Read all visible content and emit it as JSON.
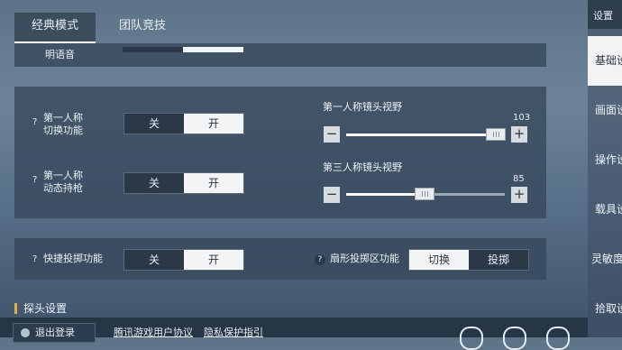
{
  "tabs": [
    {
      "label": "经典模式",
      "active": true
    },
    {
      "label": "团队竞技",
      "active": false
    }
  ],
  "top_partial": {
    "label": "明语音"
  },
  "fpp": {
    "switch": {
      "label_line1": "第一人称",
      "label_line2": "切换功能",
      "off": "关",
      "on": "开",
      "selected": "开"
    },
    "dynamic_hold": {
      "label_line1": "第一人称",
      "label_line2": "动态持枪",
      "off": "关",
      "on": "开",
      "selected": "开"
    },
    "fov_first": {
      "title": "第一人称镜头视野",
      "value": "103",
      "minus": "−",
      "plus": "+",
      "level": 0.94
    },
    "fov_third": {
      "title": "第三人称镜头视野",
      "value": "85",
      "minus": "−",
      "plus": "+",
      "level": 0.49
    }
  },
  "quick_throw": {
    "label": "快捷投掷功能",
    "off": "关",
    "on": "开",
    "selected": "开",
    "fan_label": "扇形投掷区功能",
    "fan_switch": "切换",
    "fan_throw": "投掷",
    "fan_selected": "切换"
  },
  "help_glyph": "?",
  "section_title": "探头设置",
  "footer": {
    "logout": "退出登录",
    "user_agreement": "腾讯游戏用户协议",
    "privacy": "隐私保护指引"
  },
  "sidebar": {
    "title": "设置",
    "items": [
      {
        "label": "基础设置",
        "active": true
      },
      {
        "label": "画面设置",
        "active": false
      },
      {
        "label": "操作设置",
        "active": false
      },
      {
        "label": "载具设置",
        "active": false
      },
      {
        "label": "灵敏度设置",
        "active": false
      },
      {
        "label": "拾取设置",
        "active": false
      }
    ]
  }
}
